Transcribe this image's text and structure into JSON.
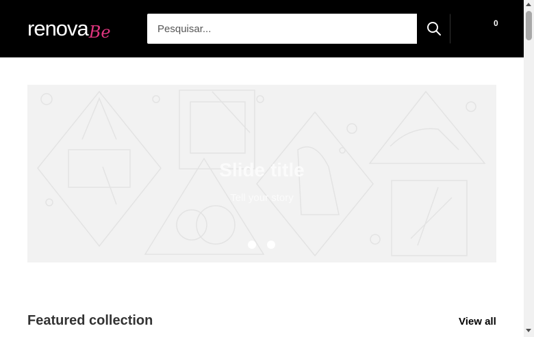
{
  "header": {
    "logo": {
      "main": "renova",
      "script": "Be"
    },
    "search": {
      "placeholder": "Pesquisar...",
      "icon": "search-icon"
    },
    "cart": {
      "icon": "shopping-bag-icon",
      "count": "0"
    }
  },
  "slideshow": {
    "title": "Slide title",
    "subtitle": "Tell your story",
    "slide_count": 2,
    "active_slide": 1
  },
  "featured": {
    "title": "Featured collection",
    "view_all": "View all"
  },
  "colors": {
    "header_bg": "#000000",
    "logo_accent": "#e0357f",
    "slide_bg": "#f2f2f2"
  }
}
